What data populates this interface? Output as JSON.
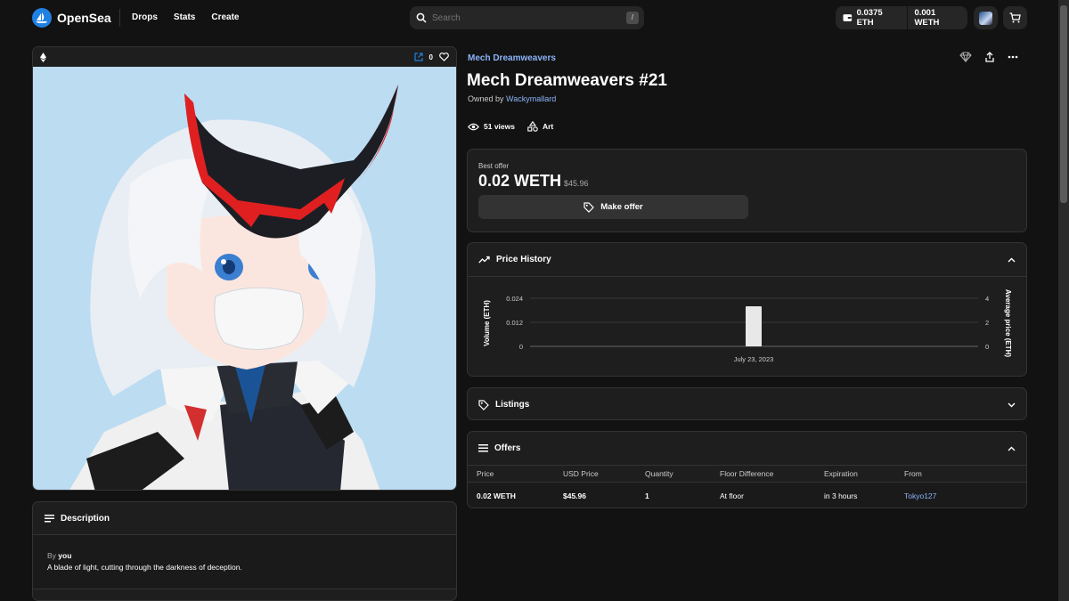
{
  "brand": {
    "name": "OpenSea",
    "accent": "#2081e2"
  },
  "nav": {
    "drops": "Drops",
    "stats": "Stats",
    "create": "Create"
  },
  "search": {
    "placeholder": "Search",
    "shortcut": "/"
  },
  "wallet": {
    "eth": "0.0375 ETH",
    "weth": "0.001 WETH"
  },
  "image_card": {
    "likes": "0"
  },
  "description": {
    "heading": "Description",
    "by_label": "By",
    "author": "you",
    "text": "A blade of light, cutting through the darkness of deception."
  },
  "item": {
    "collection": "Mech Dreamweavers",
    "title": "Mech Dreamweavers #21",
    "owned_by_label": "Owned by",
    "owner": "Wackymallard",
    "views": "51 views",
    "category": "Art"
  },
  "best_offer": {
    "label": "Best offer",
    "price": "0.02 WETH",
    "usd": "$45.96",
    "button": "Make offer"
  },
  "price_history": {
    "heading": "Price History"
  },
  "listings": {
    "heading": "Listings"
  },
  "offers": {
    "heading": "Offers",
    "columns": [
      "Price",
      "USD Price",
      "Quantity",
      "Floor Difference",
      "Expiration",
      "From"
    ],
    "rows": [
      {
        "price": "0.02 WETH",
        "usd": "$45.96",
        "quantity": "1",
        "floor": "At floor",
        "expiration": "in 3 hours",
        "from": "Tokyo127"
      }
    ]
  },
  "chart_data": {
    "type": "bar",
    "categories": [
      "July 23, 2023"
    ],
    "values": [
      0.02
    ],
    "ylabel": "Volume (ETH)",
    "y2label": "Average price (ETH)",
    "ylim": [
      0,
      0.024
    ],
    "yticks": [
      "0.024",
      "0.012",
      "0"
    ],
    "y2ticks": [
      "4",
      "2",
      "0"
    ],
    "grid": true
  }
}
